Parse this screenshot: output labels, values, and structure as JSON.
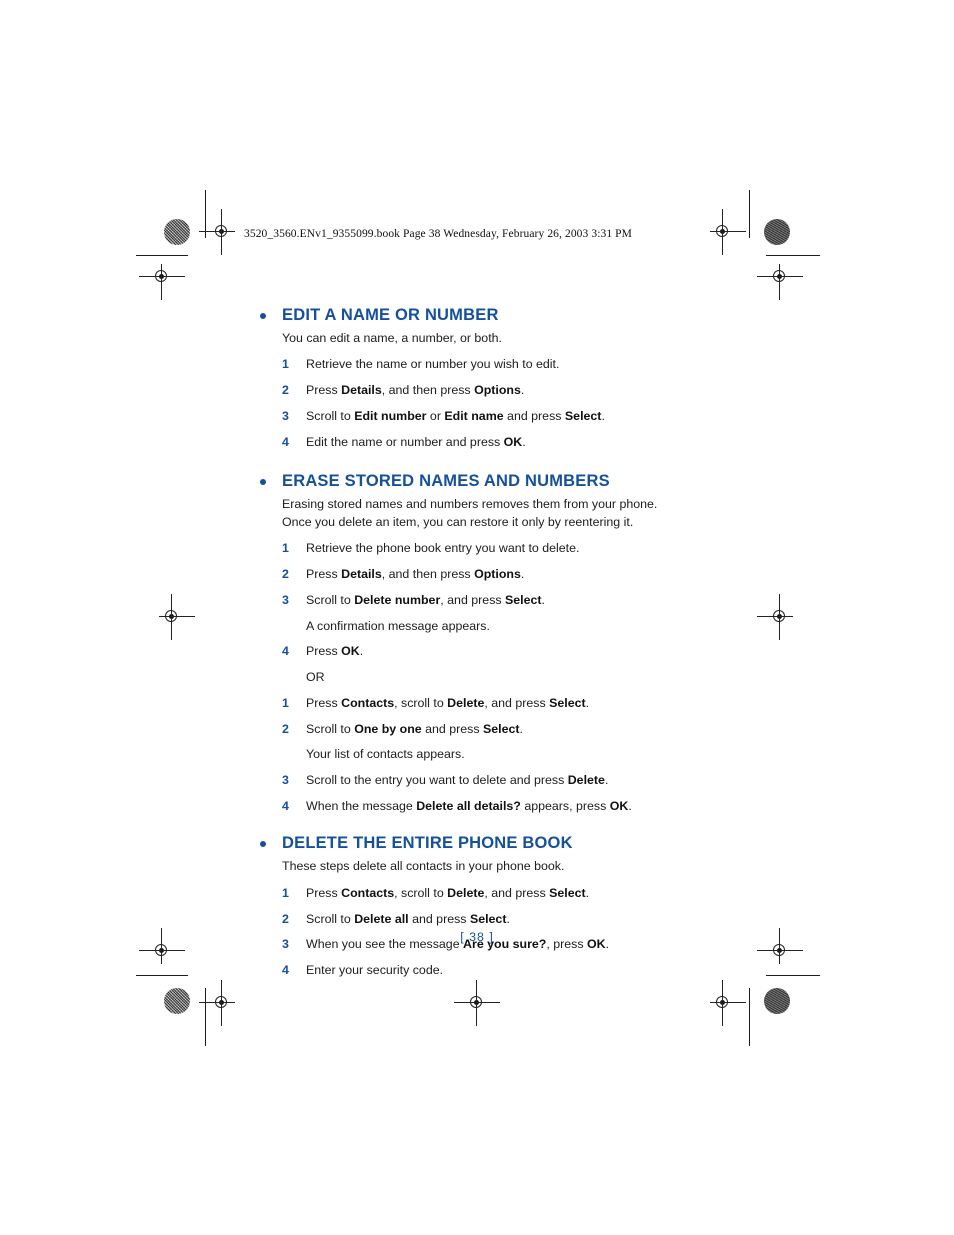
{
  "document": {
    "running_header": "3520_3560.ENv1_9355099.book  Page 38  Wednesday, February 26, 2003  3:31 PM",
    "page_number": "[ 38 ]",
    "heading_color": "#15509b",
    "body_color": "#1c1c1c"
  },
  "sections": [
    {
      "heading": "EDIT A NAME OR NUMBER",
      "intro": "You can edit a name, a number, or both.",
      "blocks": [
        {
          "type": "step",
          "num": "1",
          "html": "Retrieve the name or number you wish to edit."
        },
        {
          "type": "step",
          "num": "2",
          "html": "Press <b>Details</b>, and then press <b>Options</b>."
        },
        {
          "type": "step",
          "num": "3",
          "html": "Scroll to <b>Edit number</b> or <b>Edit name</b> and press <b>Select</b>."
        },
        {
          "type": "step",
          "num": "4",
          "html": "Edit the name or number and press <b>OK</b>."
        }
      ]
    },
    {
      "heading": "ERASE STORED NAMES AND NUMBERS",
      "intro": "Erasing stored names and numbers removes them from your phone. Once you delete an item, you can restore it only by reentering it.",
      "blocks": [
        {
          "type": "step",
          "num": "1",
          "html": "Retrieve the phone book entry you want to delete."
        },
        {
          "type": "step",
          "num": "2",
          "html": "Press <b>Details</b>, and then press <b>Options</b>."
        },
        {
          "type": "step",
          "num": "3",
          "html": "Scroll to <b>Delete number</b>, and press <b>Select</b>."
        },
        {
          "type": "note",
          "html": "A confirmation message appears."
        },
        {
          "type": "step",
          "num": "4",
          "html": "Press <b>OK</b>."
        },
        {
          "type": "or",
          "html": "OR"
        },
        {
          "type": "step",
          "num": "1",
          "html": "Press <b>Contacts</b>, scroll to <b>Delete</b>, and press <b>Select</b>."
        },
        {
          "type": "step",
          "num": "2",
          "html": "Scroll to <b>One by one</b> and press <b>Select</b>."
        },
        {
          "type": "note",
          "html": "Your list of contacts appears."
        },
        {
          "type": "step",
          "num": "3",
          "html": "Scroll to the entry you want to delete and press <b>Delete</b>."
        },
        {
          "type": "step",
          "num": "4",
          "html": "When the message <b>Delete all details?</b> appears, press <b>OK</b>."
        }
      ]
    },
    {
      "heading": "DELETE THE ENTIRE PHONE BOOK",
      "intro": "These steps delete all contacts in your phone book.",
      "blocks": [
        {
          "type": "step",
          "num": "1",
          "html": "Press <b>Contacts</b>, scroll to <b>Delete</b>, and press <b>Select</b>."
        },
        {
          "type": "step",
          "num": "2",
          "html": "Scroll to <b>Delete all</b> and press <b>Select</b>."
        },
        {
          "type": "step",
          "num": "3",
          "html": "When you see the message <b>Are you sure?</b>, press <b>OK</b>."
        },
        {
          "type": "step",
          "num": "4",
          "html": "Enter your security code."
        }
      ]
    }
  ],
  "print_marks": {
    "registration_target": "registration-target-icon",
    "density_patch": "density-patch-icon",
    "crop_rule": "crop-rule"
  }
}
